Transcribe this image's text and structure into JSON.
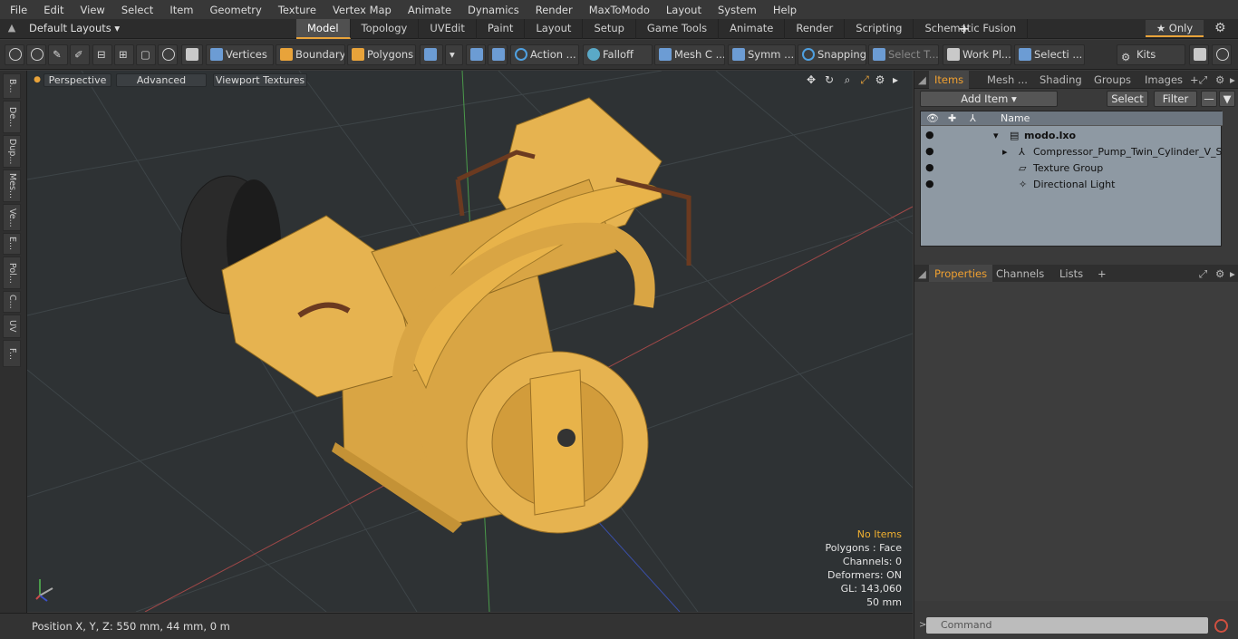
{
  "menu": [
    "File",
    "Edit",
    "View",
    "Select",
    "Item",
    "Geometry",
    "Texture",
    "Vertex Map",
    "Animate",
    "Dynamics",
    "Render",
    "MaxToModo",
    "Layout",
    "System",
    "Help"
  ],
  "layout": {
    "select": "Default Layouts ▾",
    "tabs": [
      "Model",
      "Topology",
      "UVEdit",
      "Paint",
      "Layout",
      "Setup",
      "Game Tools",
      "Animate",
      "Render",
      "Scripting",
      "Schematic Fusion"
    ],
    "active_tab": "Model",
    "only": "★  Only"
  },
  "toolbar": {
    "vertices": "Vertices",
    "boundary": "Boundary",
    "polygons": "Polygons",
    "action": "Action",
    "falloff": "Falloff",
    "mesh": "Mesh C ...",
    "symm": "Symm ...",
    "snapping": "Snapping",
    "select_t": "Select T...",
    "work_pl": "Work Pl...",
    "selecti": "Selecti ...",
    "kits": "Kits"
  },
  "left_tabs": [
    "B...",
    "De...",
    "Dup...",
    "Mes...",
    "Ve...",
    "E...",
    "Pol...",
    "C...",
    "UV",
    "F..."
  ],
  "viewport": {
    "perspective": "Perspective",
    "advanced": "Advanced",
    "textures": "Viewport Textures",
    "stats": {
      "items": "No Items",
      "polygons": "Polygons : Face",
      "channels": "Channels: 0",
      "deformers": "Deformers: ON",
      "gl": "GL: 143,060",
      "size": "50 mm"
    }
  },
  "status": {
    "position": "Position X, Y, Z:   550 mm, 44 mm, 0 m"
  },
  "items_panel": {
    "tabs": [
      "Items",
      "Mesh ...",
      "Shading",
      "Groups",
      "Images"
    ],
    "add_item": "Add Item",
    "select": "Select",
    "filter": "Filter",
    "name_col": "Name",
    "rows": [
      {
        "label": "modo.lxo"
      },
      {
        "label": "Compressor_Pump_Twin_Cylinder_V_St ..."
      },
      {
        "label": "Texture Group"
      },
      {
        "label": "Directional Light"
      }
    ]
  },
  "props_panel": {
    "tabs": [
      "Properties",
      "Channels",
      "Lists"
    ]
  },
  "command": {
    "placeholder": "Command"
  },
  "colors": {
    "accent": "#e8a33a",
    "model": "#e8b04a"
  }
}
